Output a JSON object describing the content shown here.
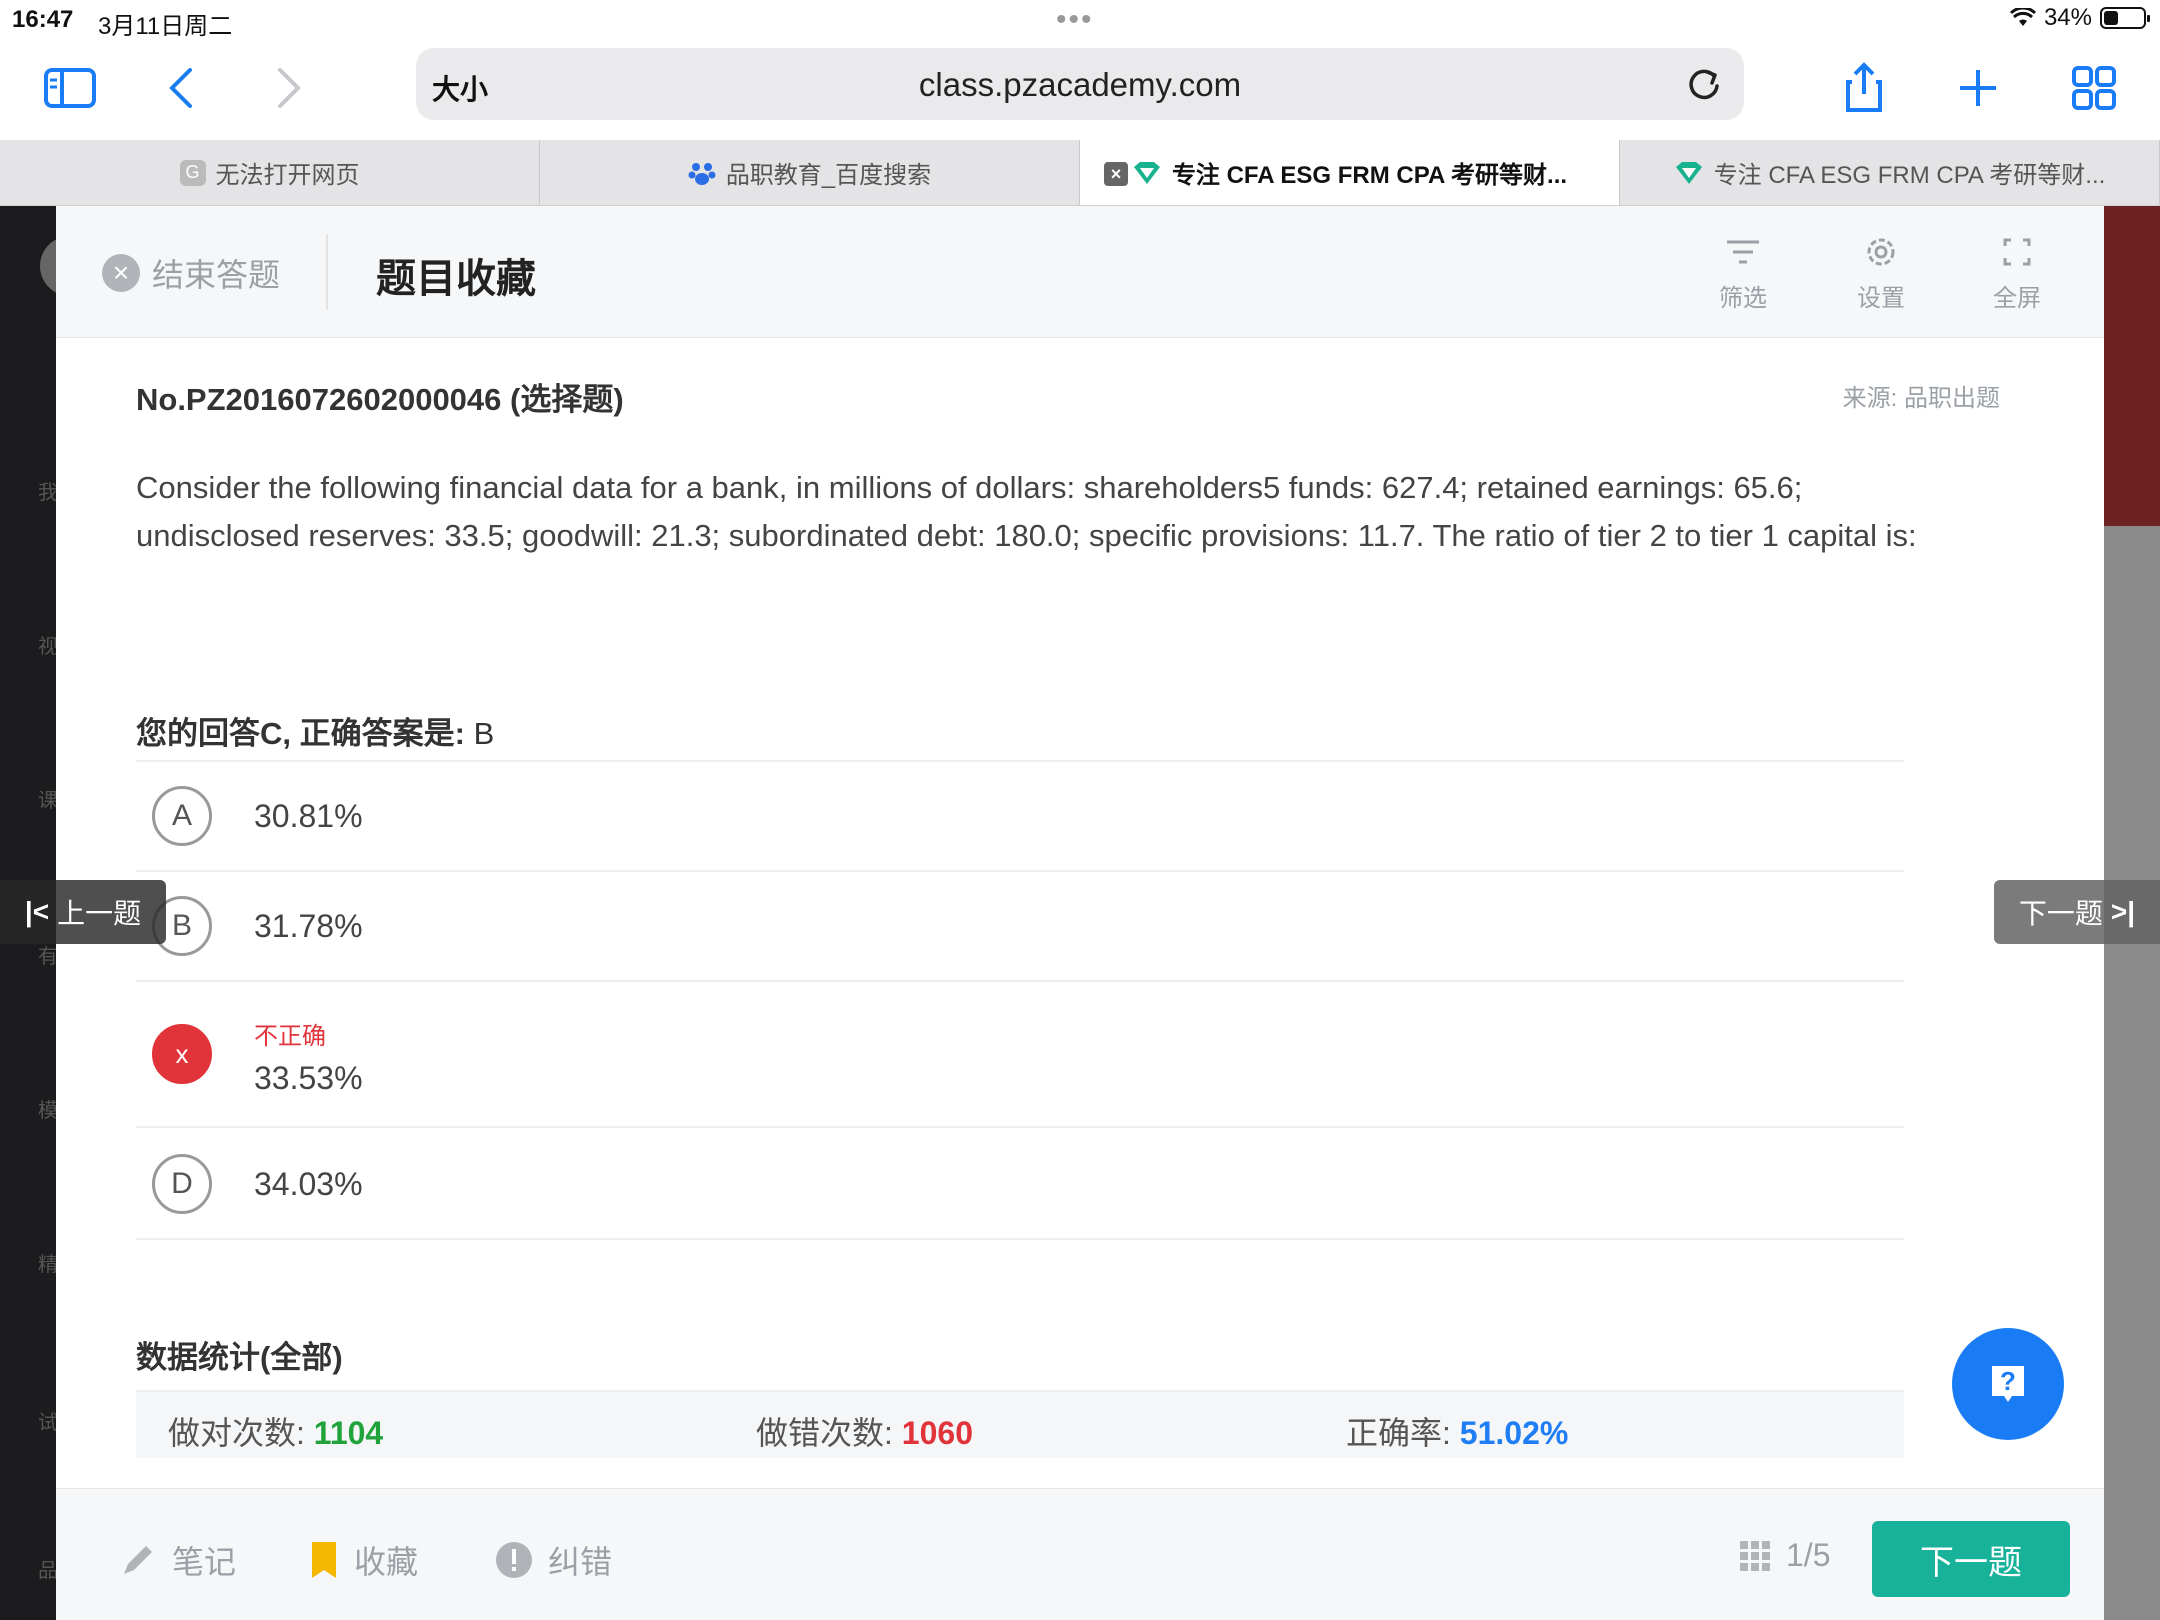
{
  "status": {
    "time": "16:47",
    "date": "3月11日周二",
    "battery": "34%"
  },
  "browser": {
    "size_label": "大小",
    "url": "class.pzacademy.com",
    "tabs": [
      {
        "label": "无法打开网页",
        "favicon": "G"
      },
      {
        "label": "品职教育_百度搜索",
        "favicon": "baidu-icon"
      },
      {
        "label": "专注 CFA ESG FRM CPA 考研等财...",
        "favicon": "pz-icon"
      },
      {
        "label": "专注 CFA ESG FRM CPA 考研等财...",
        "favicon": "pz-icon"
      }
    ]
  },
  "background_page": {
    "left_labels": [
      "我",
      "视",
      "课",
      "有",
      "模",
      "精",
      "试",
      "品"
    ]
  },
  "panel": {
    "end_label": "结束答题",
    "title": "题目收藏",
    "tools": {
      "filter": "筛选",
      "settings": "设置",
      "fullscreen": "全屏"
    }
  },
  "question": {
    "number": "No.PZ2016072602000046 (选择题)",
    "source": "来源: 品职出题",
    "text": "Consider the following financial data for a bank, in millions of dollars: shareholders5 funds: 627.4; retained earnings: 65.6; undisclosed reserves: 33.5; goodwill: 21.3; subordinated debt: 180.0; specific provisions: 11.7. The ratio of tier 2 to tier 1 capital is:",
    "answer_prefix": "您的回答C, 正确答案是: ",
    "correct_answer": "B",
    "options": [
      {
        "letter": "A",
        "text": "30.81%"
      },
      {
        "letter": "B",
        "text": "31.78%"
      },
      {
        "letter": "x",
        "flag": "不正确",
        "text": "33.53%"
      },
      {
        "letter": "D",
        "text": "34.03%"
      }
    ]
  },
  "stats": {
    "title": "数据统计(全部)",
    "correct_label": "做对次数: ",
    "correct_value": "1104",
    "wrong_label": "做错次数: ",
    "wrong_value": "1060",
    "rate_label": "正确率: ",
    "rate_value": "51.02%"
  },
  "footer": {
    "note": "笔记",
    "favorite": "收藏",
    "report": "纠错",
    "progress": "1/5",
    "next": "下一题"
  },
  "side_nav": {
    "prev": "上一题",
    "next": "下一题"
  },
  "colors": {
    "accent_blue": "#1a7cf5",
    "correct_green": "#1fa33a",
    "wrong_red": "#e0333a",
    "next_button": "#18b29b"
  }
}
